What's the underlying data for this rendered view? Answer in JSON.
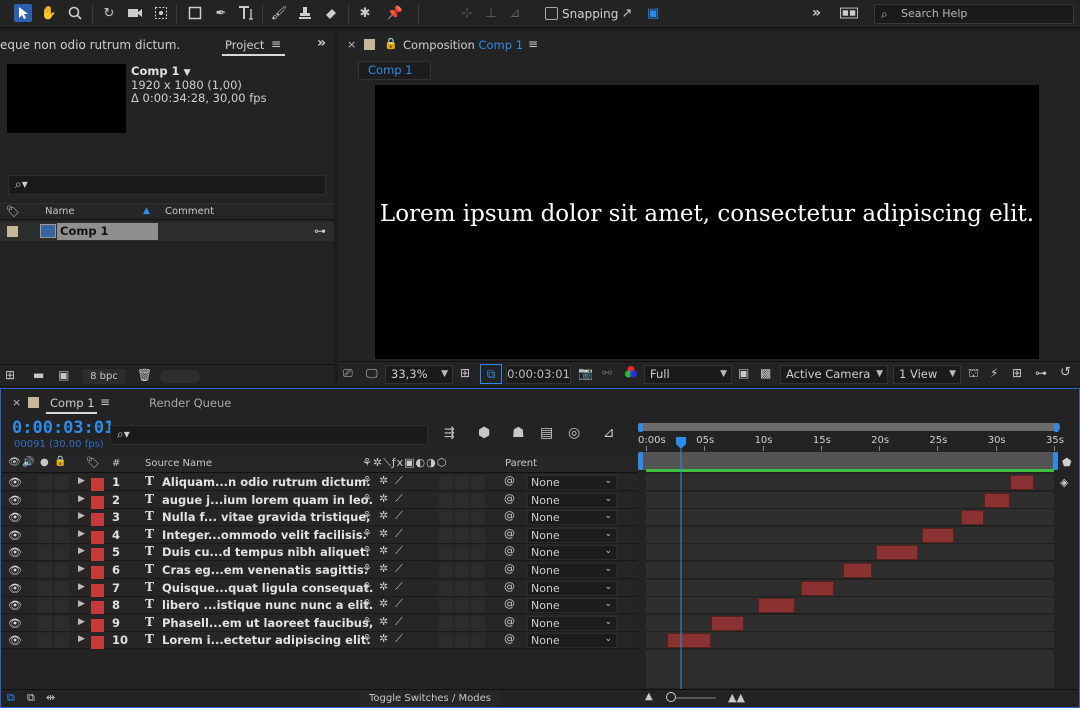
{
  "toolbar": {
    "snapping_label": "Snapping",
    "search_help_placeholder": "Search Help",
    "expand_glyph": "»"
  },
  "project": {
    "truncated_info_text": "eque non odio rutrum dictum.",
    "tab_label": "Project",
    "selected_item": {
      "name": "Comp 1",
      "dimensions": "1920 x 1080 (1,00)",
      "duration_fps": "Δ 0:00:34:28, 30,00 fps"
    },
    "columns": {
      "name": "Name",
      "comment": "Comment"
    },
    "items": [
      {
        "name": "Comp 1"
      }
    ],
    "bpc_label": "8 bpc"
  },
  "composition": {
    "panel_label": "Composition",
    "comp_name": "Comp 1",
    "flow_tab": "Comp 1",
    "viewer_text": "Lorem ipsum dolor sit amet, consectetur adipiscing elit.",
    "zoom": "33,3%",
    "timecode": "0:00:03:01",
    "resolution": "Full",
    "camera": "Active Camera",
    "view_layout": "1 View"
  },
  "timeline": {
    "tabs": {
      "comp": "Comp 1",
      "render_queue": "Render Queue"
    },
    "current_time": "0:00:03:01",
    "current_frame": "00091 (30.00 fps)",
    "columns": {
      "num": "#",
      "source_name": "Source Name",
      "parent": "Parent"
    },
    "ruler_labels": [
      "0:00s",
      "05s",
      "10s",
      "15s",
      "20s",
      "25s",
      "30s",
      "35s"
    ],
    "duration_seconds": 35,
    "current_time_seconds": 3.03,
    "layers": [
      {
        "num": "1",
        "type": "T",
        "name": "Aliquam...n odio rutrum dictum.",
        "parent": "None",
        "in_s": 31.2,
        "out_s": 33.3,
        "label_color": "#c53a3a"
      },
      {
        "num": "2",
        "type": "T",
        "name": "augue j...ium lorem quam in leo.",
        "parent": "None",
        "in_s": 29.0,
        "out_s": 31.2,
        "label_color": "#c53a3a"
      },
      {
        "num": "3",
        "type": "T",
        "name": "Nulla f... vitae gravida tristique,",
        "parent": "None",
        "in_s": 27.0,
        "out_s": 29.0,
        "label_color": "#c53a3a"
      },
      {
        "num": "4",
        "type": "T",
        "name": "Integer...ommodo velit facilisis.",
        "parent": "None",
        "in_s": 23.7,
        "out_s": 26.4,
        "label_color": "#c53a3a"
      },
      {
        "num": "5",
        "type": "T",
        "name": "Duis cu...d tempus nibh aliquet.",
        "parent": "None",
        "in_s": 19.7,
        "out_s": 23.3,
        "label_color": "#c53a3a"
      },
      {
        "num": "6",
        "type": "T",
        "name": "Cras eg...em venenatis sagittis.",
        "parent": "None",
        "in_s": 16.9,
        "out_s": 19.4,
        "label_color": "#c53a3a"
      },
      {
        "num": "7",
        "type": "T",
        "name": "Quisque...quat ligula consequat.",
        "parent": "None",
        "in_s": 13.3,
        "out_s": 16.1,
        "label_color": "#c53a3a"
      },
      {
        "num": "8",
        "type": "T",
        "name": "libero ...istique nunc nunc a elit.",
        "parent": "None",
        "in_s": 9.6,
        "out_s": 12.8,
        "label_color": "#c53a3a"
      },
      {
        "num": "9",
        "type": "T",
        "name": "Phasell...em ut laoreet faucibus,",
        "parent": "None",
        "in_s": 5.6,
        "out_s": 8.4,
        "label_color": "#c53a3a"
      },
      {
        "num": "10",
        "type": "T",
        "name": "Lorem i...ectetur adipiscing elit.",
        "parent": "None",
        "in_s": 1.8,
        "out_s": 5.6,
        "label_color": "#c53a3a"
      }
    ],
    "toggle_label": "Toggle Switches / Modes",
    "colors": {
      "accent": "#2d8ceb",
      "work_area": "#3fbf3f",
      "layer_bar": "#8a3232",
      "panel_border": "#2d62c6"
    }
  }
}
